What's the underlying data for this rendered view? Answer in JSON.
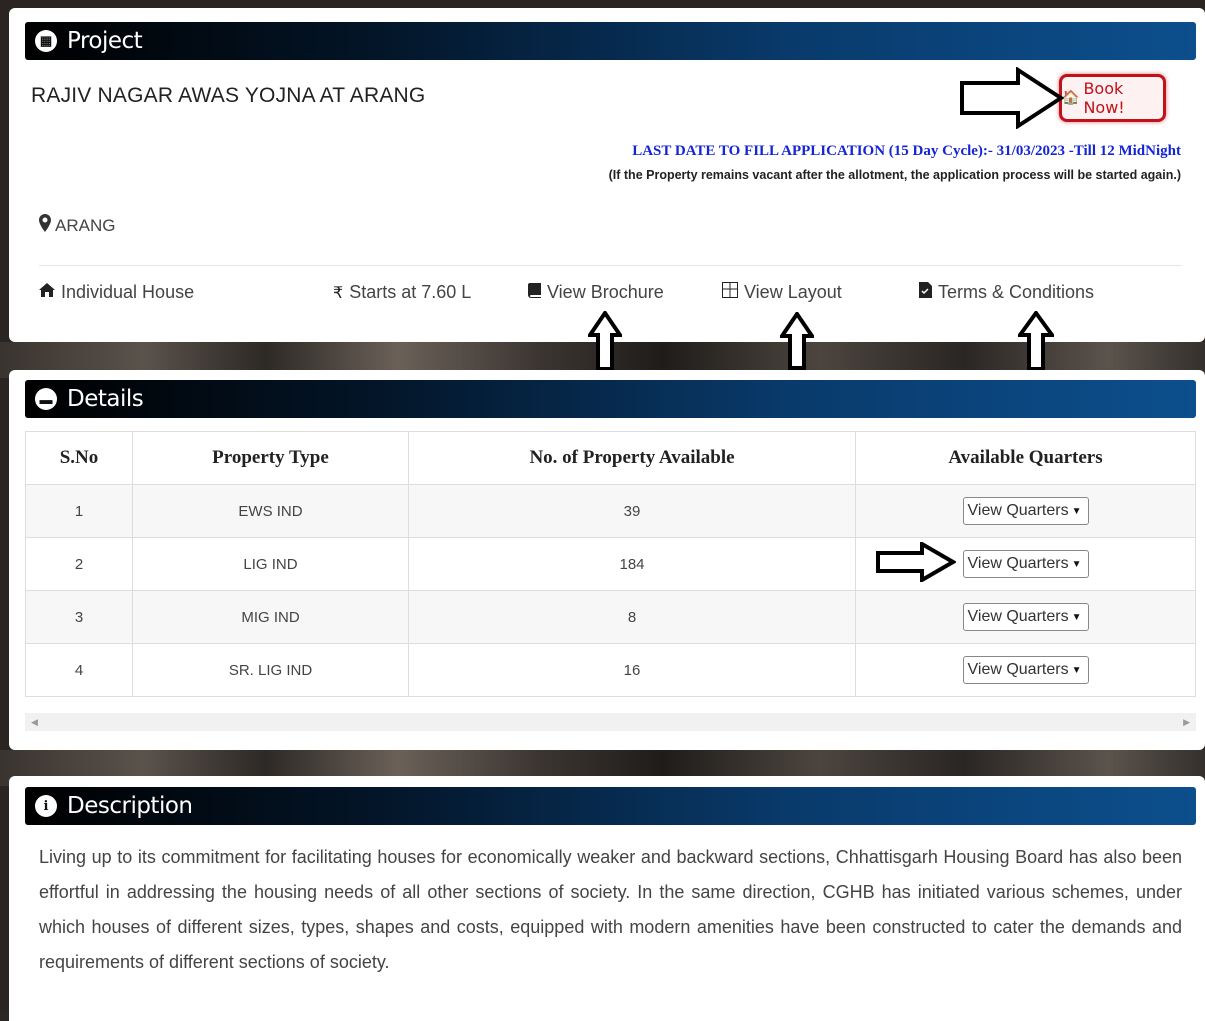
{
  "project": {
    "header_title": "Project",
    "name": "RAJIV NAGAR AWAS YOJNA AT ARANG",
    "book_button": "Book Now!",
    "last_date": "LAST DATE TO FILL APPLICATION (15 Day Cycle):- 31/03/2023 -Till 12 MidNight",
    "vacant_note": "(If the Property remains vacant after the allotment, the application process will be started again.)",
    "location": "ARANG",
    "house_type": "Individual House",
    "price": "Starts at 7.60 L",
    "brochure_link": "View Brochure",
    "layout_link": "View Layout",
    "terms_link": "Terms & Conditions"
  },
  "details": {
    "header_title": "Details",
    "columns": [
      "S.No",
      "Property Type",
      "No. of Property Available",
      "Available Quarters"
    ],
    "rows": [
      {
        "sno": "1",
        "type": "EWS IND",
        "available": "39",
        "quarters": "View Quarters"
      },
      {
        "sno": "2",
        "type": "LIG IND",
        "available": "184",
        "quarters": "View Quarters"
      },
      {
        "sno": "3",
        "type": "MIG IND",
        "available": "8",
        "quarters": "View Quarters"
      },
      {
        "sno": "4",
        "type": "SR. LIG IND",
        "available": "16",
        "quarters": "View Quarters"
      }
    ]
  },
  "description": {
    "header_title": "Description",
    "text": "Living up to its commitment for facilitating houses for economically weaker and backward sections, Chhattisgarh Housing Board has also been effortful in addressing the housing needs of all other sections of society. In the same direction, CGHB has initiated various schemes, under which houses of different sizes, types, shapes and costs, equipped with modern amenities have been constructed to cater the demands and requirements of different sections of society."
  },
  "icons": {
    "project": "building-icon",
    "details": "briefcase-icon",
    "description": "info-icon",
    "location": "map-pin-icon",
    "house": "home-icon",
    "price": "rupee-icon",
    "brochure": "book-icon",
    "layout": "grid-icon",
    "terms": "document-icon"
  },
  "colors": {
    "header_gradient_end": "#0c4f8d",
    "book_button_border": "#c1121b",
    "last_date_text": "#1425d6"
  }
}
